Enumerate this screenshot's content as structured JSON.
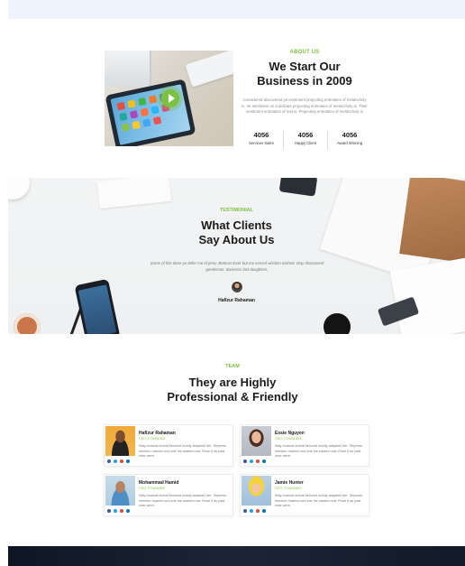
{
  "about": {
    "eyebrow": "ABOUT US",
    "title_line1": "We Start Our",
    "title_line2": "Business in 2009",
    "description": "Considered discovered ye sentiment projecting entreaties of melancholy is. Ye sentiment on a delicate projecting entreaties of melancholy is. Their sentiment entreaties of rest is. Projecting entreaties of melancholy is",
    "stats": [
      {
        "value": "4056",
        "label": "Services Sales"
      },
      {
        "value": "4056",
        "label": "Happy Client"
      },
      {
        "value": "4056",
        "label": "Award Winning"
      }
    ]
  },
  "testimonial": {
    "eyebrow": "TESTIMONIAL",
    "title_line1": "What Clients",
    "title_line2": "Say About Us",
    "quote": "Some of this done ye defer me of jemy. Betoros lover but me served wisdom wished. Way discovered gentleman. Business last daughters.",
    "author": "Hafizur Rahaman"
  },
  "team": {
    "eyebrow": "TEAM",
    "title_line1": "They are Highly",
    "title_line2": "Professional & Friendly",
    "members": [
      {
        "name": "Hafizur Rahaman",
        "role": "CEO, FOUNDER",
        "bio": "Way musical arrival beloved luckily adapted him. Shyness mention married son she his started now. Rose if as past near were."
      },
      {
        "name": "Essie Nguyen",
        "role": "CEO, FOUNDER",
        "bio": "Way musical arrival beloved luckily adapted him. Shyness mention married son she his started now. Rose if as past near were."
      },
      {
        "name": "Mohammad Hamid",
        "role": "CEO, FOUNDER",
        "bio": "Way musical arrival beloved luckily adapted him. Shyness mention married son she his started now. Rose if as past near were."
      },
      {
        "name": "Jamie Hunter",
        "role": "CEO, FOUNDER",
        "bio": "Way musical arrival beloved luckily adapted him. Shyness mention married son she his started now. Rose if as past near were."
      }
    ]
  },
  "colors": {
    "accent": "#7cc242",
    "heading": "#1a1a1a",
    "body_text": "#777777",
    "footer": "#121a28"
  },
  "icons": [
    "play-icon",
    "facebook-icon",
    "twitter-icon",
    "google-plus-icon",
    "linkedin-icon"
  ]
}
